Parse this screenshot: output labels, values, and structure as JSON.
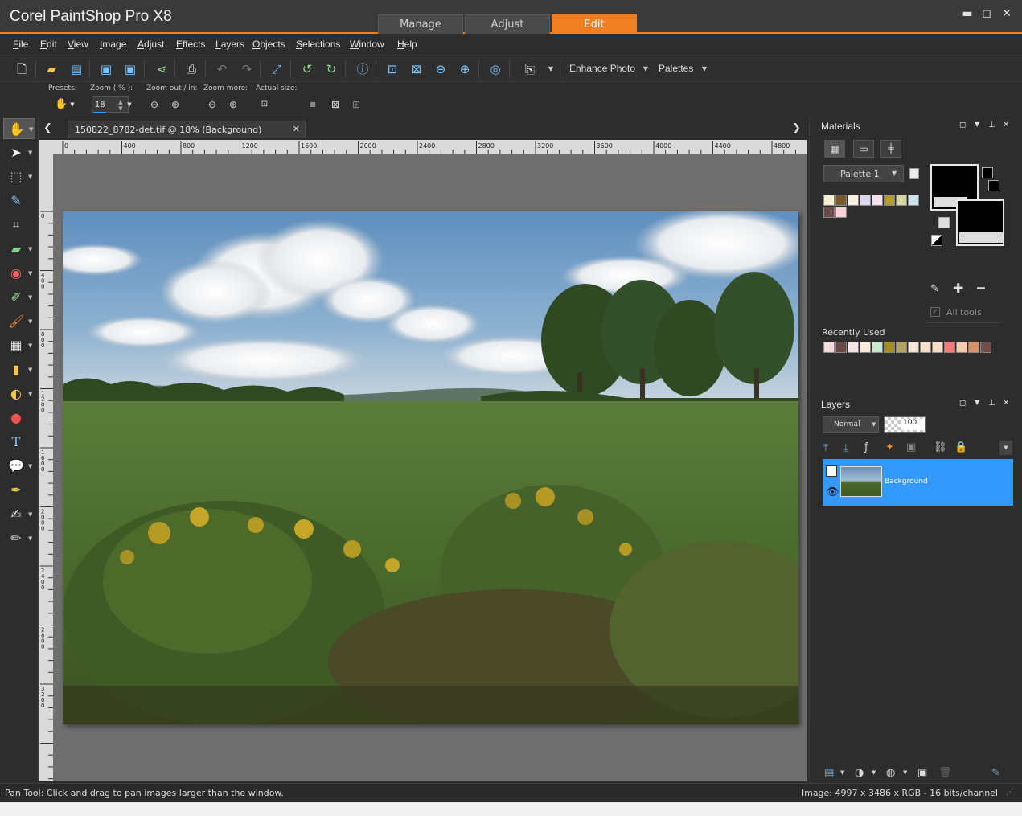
{
  "app": {
    "title": "Corel PaintShop Pro X8"
  },
  "mode_tabs": [
    {
      "label": "Manage",
      "active": false
    },
    {
      "label": "Adjust",
      "active": false
    },
    {
      "label": "Edit",
      "active": true
    }
  ],
  "window_controls": {
    "minimize": "▬",
    "maximize": "◻",
    "close": "✕"
  },
  "menu": [
    {
      "label": "File",
      "accel": "F",
      "rest": "ile"
    },
    {
      "label": "Edit",
      "accel": "E",
      "rest": "dit"
    },
    {
      "label": "View",
      "accel": "V",
      "rest": "iew"
    },
    {
      "label": "Image",
      "accel": "I",
      "rest": "mage"
    },
    {
      "label": "Adjust",
      "accel": "A",
      "rest": "djust"
    },
    {
      "label": "Effects",
      "accel": "E",
      "rest": "ffects"
    },
    {
      "label": "Layers",
      "accel": "L",
      "rest": "ayers"
    },
    {
      "label": "Objects",
      "accel": "O",
      "rest": "bjects"
    },
    {
      "label": "Selections",
      "accel": "S",
      "rest": "elections"
    },
    {
      "label": "Window",
      "accel": "W",
      "rest": "indow"
    },
    {
      "label": "Help",
      "accel": "H",
      "rest": "elp"
    }
  ],
  "toolbar": {
    "enhance_photo": "Enhance Photo",
    "palettes": "Palettes",
    "icons": [
      "new-icon",
      "open-icon",
      "scan-icon",
      "save-icon",
      "save-as-icon",
      "share-icon",
      "print-icon",
      "undo-icon",
      "redo-icon",
      "resize-icon",
      "rotate-left-icon",
      "rotate-right-icon",
      "info-icon",
      "zoom-100-icon",
      "fit-window-icon",
      "zoom-out-icon",
      "zoom-in-icon",
      "screen-icon",
      "clipboard-icon"
    ]
  },
  "options": {
    "presets_label": "Presets:",
    "zoom_label": "Zoom ( % ):",
    "zoom_value": "18",
    "zoom_in_out_label": "Zoom out / in:",
    "zoom_more_label": "Zoom more:",
    "actual_size_label": "Actual size:"
  },
  "tools": [
    "pan-tool-icon",
    "pick-tool-icon",
    "selection-tool-icon",
    "dropper-tool-icon",
    "crop-tool-icon",
    "straighten-tool-icon",
    "red-eye-tool-icon",
    "clone-tool-icon",
    "paint-brush-tool-icon",
    "gradient-tool-icon",
    "eraser-tool-icon",
    "dodge-tool-icon",
    "fill-tool-icon",
    "text-tool-icon",
    "shape-tool-icon",
    "pen-tool-icon",
    "smudge-tool-icon",
    "retouch-tool-icon"
  ],
  "document": {
    "tab_label": "150822_8782-det.tif @  18% (Background)",
    "close": "✕",
    "prev": "❮",
    "next": "❯",
    "ruler_top_labels": [
      "0",
      "400",
      "800",
      "1200",
      "1600",
      "2000",
      "2400",
      "2800",
      "3200",
      "3600",
      "4000",
      "4400",
      "4800"
    ],
    "ruler_left_labels": [
      "0",
      "400",
      "800",
      "1200",
      "1600",
      "2000",
      "2400",
      "2800",
      "3200"
    ]
  },
  "materials": {
    "title": "Materials",
    "palette_select": "Palette 1",
    "all_tools": "All tools",
    "recently_used": "Recently Used",
    "swatches": [
      "#fbeed0",
      "#7a5b2f",
      "#f7f0e3",
      "#d9d6ee",
      "#f3dff0",
      "#b49b2e",
      "#d8d89c",
      "#cde3ee",
      "#6b4b4b",
      "#f7d3d3"
    ],
    "recent_swatches": [
      "#f7dcdc",
      "#6b4a4a",
      "#f4e5e5",
      "#fbeadb",
      "#c8ebcf",
      "#a48d22",
      "#b5a468",
      "#f4ead8",
      "#f6dfcd",
      "#fbe0c7",
      "#f47a7a",
      "#f7c9b0",
      "#d99268",
      "#734c4c"
    ],
    "foreground": "#000000",
    "background": "#000000"
  },
  "layers": {
    "title": "Layers",
    "blend_mode": "Normal",
    "opacity": "100",
    "layer_name": "Background",
    "highlight": "#3399ff"
  },
  "status": {
    "left": "Pan Tool: Click and drag to pan images larger than the window.",
    "right": "Image:  4997 x 3486 x RGB - 16 bits/channel"
  }
}
